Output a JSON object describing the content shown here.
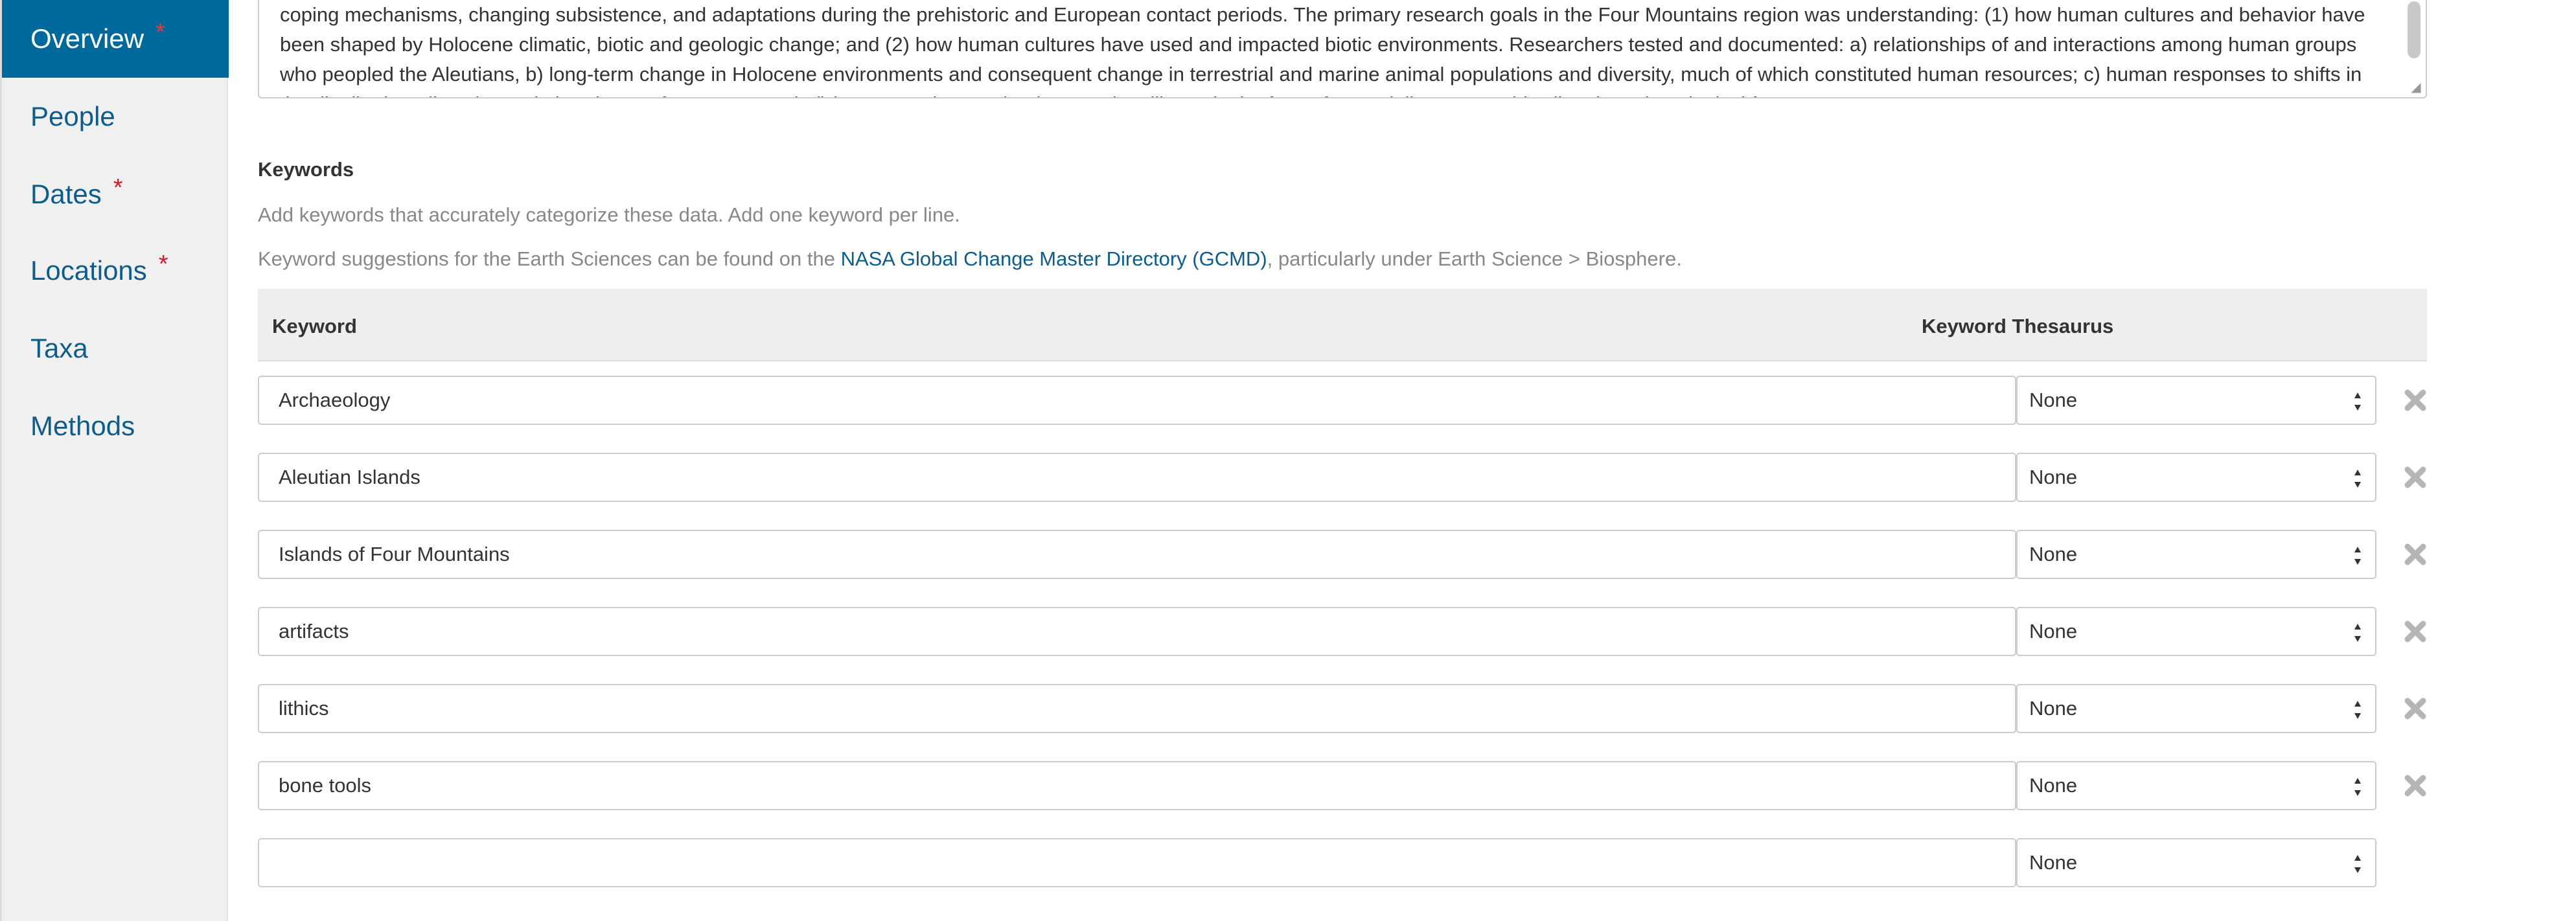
{
  "sidebar": {
    "items": [
      {
        "label": "Overview",
        "required": "*",
        "active": true
      },
      {
        "label": "People",
        "required": "",
        "active": false
      },
      {
        "label": "Dates",
        "required": "*",
        "active": false
      },
      {
        "label": "Locations",
        "required": "*",
        "active": false
      },
      {
        "label": "Taxa",
        "required": "",
        "active": false
      },
      {
        "label": "Methods",
        "required": "",
        "active": false
      }
    ]
  },
  "abstract": {
    "lines": [
      "coping mechanisms, changing subsistence, and adaptations during the prehistoric and European contact periods. The primary research goals in the Four Mountains region was understanding: (1) how human cultures and behavior have",
      "been shaped by Holocene climatic, biotic and geologic change; and (2) how human cultures have used and impacted biotic environments. Researchers tested and documented: a) relationships of and interactions among human groups",
      "who peopled the Aleutians, b) long-term change in Holocene environments and consequent change in terrestrial and marine animal populations and diversity, much of which constituted human resources; c) human responses to shifts in",
      "the distribution, diversity, and abundance of resources and, d) human coping mechanisms and resilience in the face of potentially catastrophic climatic and geological forces."
    ]
  },
  "keywords": {
    "title": "Keywords",
    "help1": "Add keywords that accurately categorize these data. Add one keyword per line.",
    "help2_before": "Keyword suggestions for the Earth Sciences can be found on the ",
    "help2_link": "NASA Global Change Master Directory (GCMD)",
    "help2_after": ", particularly under Earth Science > Biosphere.",
    "col_keyword": "Keyword",
    "col_thesaurus": "Keyword Thesaurus",
    "rows": [
      {
        "value": "Archaeology",
        "thesaurus": "None"
      },
      {
        "value": "Aleutian Islands",
        "thesaurus": "None"
      },
      {
        "value": "Islands of Four Mountains",
        "thesaurus": "None"
      },
      {
        "value": "artifacts",
        "thesaurus": "None"
      },
      {
        "value": "lithics",
        "thesaurus": "None"
      },
      {
        "value": "bone tools",
        "thesaurus": "None"
      }
    ],
    "new_row": {
      "value": "",
      "thesaurus": "None"
    }
  },
  "colors": {
    "accent": "#00699b",
    "link": "#0c5c8c",
    "required": "#d9192a"
  }
}
